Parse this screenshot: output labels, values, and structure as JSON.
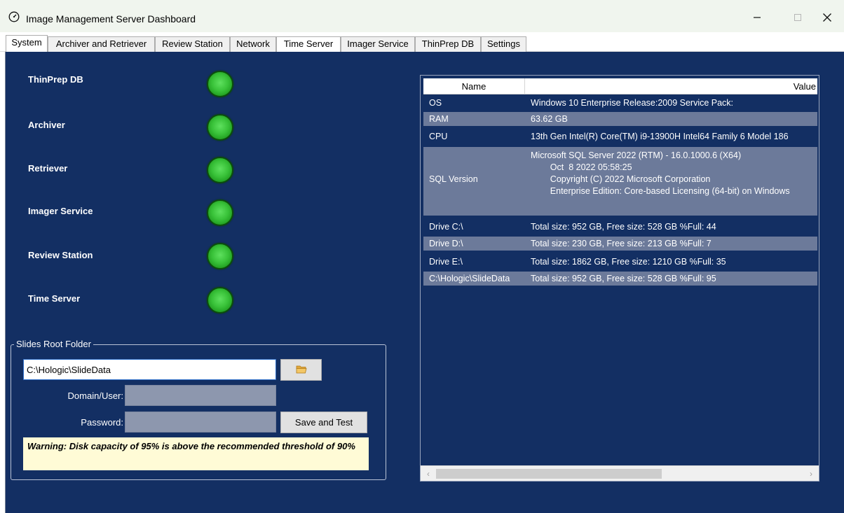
{
  "window": {
    "title": "Image Management Server Dashboard",
    "app_icon": "gauge-icon",
    "controls": {
      "minimize": "—",
      "maximize": "☐",
      "close": "✕"
    }
  },
  "tabs": [
    {
      "label": "System",
      "active": true
    },
    {
      "label": "Archiver and Retriever"
    },
    {
      "label": "Review Station"
    },
    {
      "label": "Network"
    },
    {
      "label": "Time Server",
      "highlighted": true
    },
    {
      "label": "Imager Service"
    },
    {
      "label": "ThinPrep DB"
    },
    {
      "label": "Settings"
    }
  ],
  "services": [
    {
      "label": "ThinPrep DB",
      "status": "ok"
    },
    {
      "label": "Archiver",
      "status": "ok"
    },
    {
      "label": "Retriever",
      "status": "ok"
    },
    {
      "label": "Imager Service",
      "status": "ok"
    },
    {
      "label": "Review Station",
      "status": "ok"
    },
    {
      "label": "Time Server",
      "status": "ok"
    }
  ],
  "slides_root": {
    "group_title": "Slides Root Folder",
    "path_value": "C:\\Hologic\\SlideData",
    "domain_user_label": "Domain/User:",
    "password_label": "Password:",
    "save_label": "Save and Test",
    "browse_icon": "folder-open-icon",
    "warning": "Warning: Disk capacity of 95% is above the recommended threshold of 90%"
  },
  "info_grid": {
    "columns": {
      "name": "Name",
      "value": "Value"
    },
    "rows": [
      {
        "name": "OS",
        "value": "Windows 10 Enterprise Release:2009  Service Pack:"
      },
      {
        "name": "RAM",
        "value": "63.62 GB"
      },
      {
        "name": "CPU",
        "value": " 13th Gen Intel(R) Core(TM) i9-13900H Intel64 Family 6 Model 186"
      },
      {
        "name": "SQL Version",
        "value": "Microsoft SQL Server 2022 (RTM) - 16.0.1000.6 (X64) \n\tOct  8 2022 05:58:25 \n\tCopyright (C) 2022 Microsoft Corporation\n\tEnterprise Edition: Core-based Licensing (64-bit) on Windows"
      },
      {
        "name": "Drive C:\\",
        "value": "Total size: 952 GB, Free size: 528 GB  %Full: 44"
      },
      {
        "name": "Drive D:\\",
        "value": "Total size: 230 GB, Free size: 213 GB  %Full: 7"
      },
      {
        "name": "Drive E:\\",
        "value": "Total size: 1862 GB, Free size: 1210 GB  %Full: 35"
      },
      {
        "name": "C:\\Hologic\\SlideData",
        "value": "Total size: 952 GB, Free size: 528 GB  %Full: 95"
      }
    ]
  },
  "colors": {
    "panel_bg": "#132f63",
    "alt_row": "#6c7a9a",
    "led_green": "#39c239",
    "warning_bg": "#fffbd6"
  }
}
